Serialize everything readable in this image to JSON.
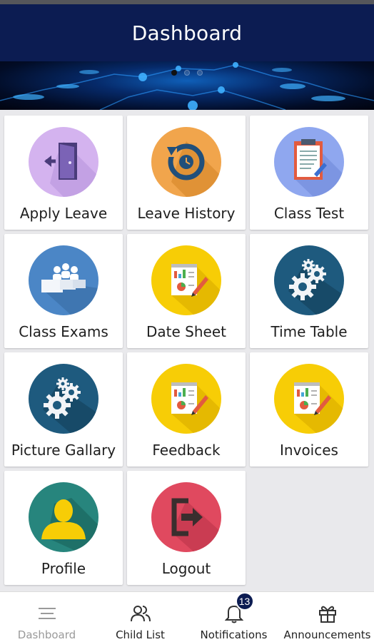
{
  "header": {
    "title": "Dashboard"
  },
  "banner": {
    "slides": 3,
    "active_slide": 1
  },
  "colors": {
    "appbar": "#0c1c52",
    "apply_leave": "#d4b3ef",
    "leave_history": "#f1a54c",
    "class_test": "#8fa7ef",
    "class_exams": "#4b86c6",
    "date_sheet": "#f7cd06",
    "time_table": "#1e5a7e",
    "profile": "#27857d",
    "logout": "#e0495f"
  },
  "tiles": [
    {
      "label": "Apply Leave",
      "icon": "door-exit-icon"
    },
    {
      "label": "Leave History",
      "icon": "history-icon"
    },
    {
      "label": "Class Test",
      "icon": "clipboard-icon"
    },
    {
      "label": "Class Exams",
      "icon": "classroom-icon"
    },
    {
      "label": "Date Sheet",
      "icon": "report-icon"
    },
    {
      "label": "Time Table",
      "icon": "gears-icon"
    },
    {
      "label": "Picture Gallary",
      "icon": "gears-icon"
    },
    {
      "label": "Feedback",
      "icon": "report-icon"
    },
    {
      "label": "Invoices",
      "icon": "report-icon"
    },
    {
      "label": "Profile",
      "icon": "user-icon"
    },
    {
      "label": "Logout",
      "icon": "logout-icon"
    }
  ],
  "bottom_nav": [
    {
      "label": "Dashboard",
      "icon": "menu-lines-icon",
      "active": true
    },
    {
      "label": "Child List",
      "icon": "users-icon"
    },
    {
      "label": "Notifications",
      "icon": "bell-icon",
      "badge": "13"
    },
    {
      "label": "Announcements",
      "icon": "gift-icon"
    }
  ]
}
